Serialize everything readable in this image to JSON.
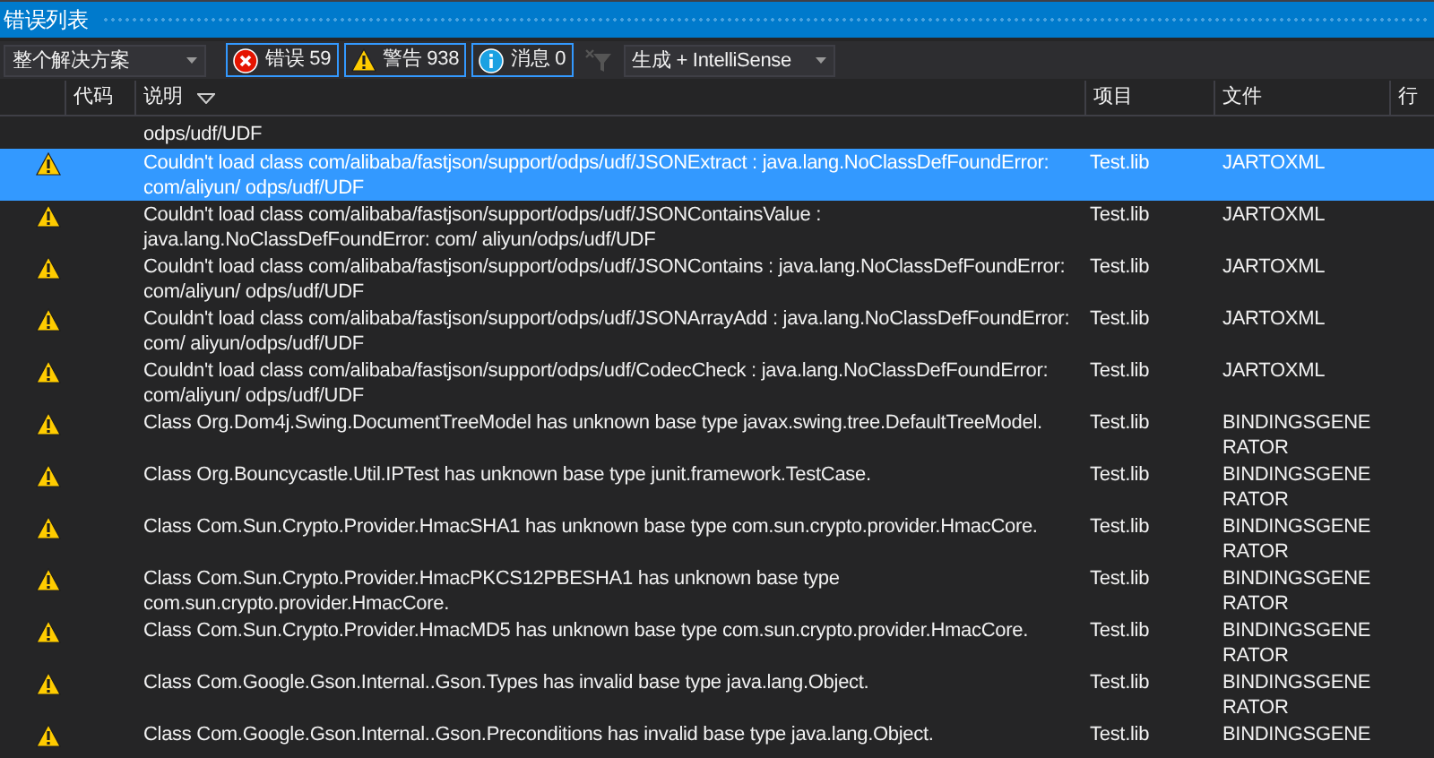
{
  "window": {
    "title": "错误列表"
  },
  "toolbar": {
    "scope": "整个解决方案",
    "filters": [
      {
        "kind": "error",
        "label": "错误 59",
        "selected": true
      },
      {
        "kind": "warning",
        "label": "警告 938",
        "selected": true
      },
      {
        "kind": "info",
        "label": "消息 0",
        "selected": true
      }
    ],
    "filter_button": {
      "disabled": true
    },
    "source": "生成 + IntelliSense"
  },
  "table": {
    "columns": [
      "代码",
      "说明",
      "项目",
      "文件",
      "行"
    ],
    "rows": [
      {
        "kind": "partial",
        "description": "odps/udf/UDF",
        "selected": false
      },
      {
        "kind": "warning",
        "description": "Couldn't load class com/alibaba/fastjson/support/odps/udf/JSONExtract : java.lang.NoClassDefFoundError: com/aliyun/ odps/udf/UDF",
        "project": "Test.lib",
        "file": "JARTOXML",
        "selected": true
      },
      {
        "kind": "warning",
        "description": "Couldn't load class com/alibaba/fastjson/support/odps/udf/JSONContainsValue : java.lang.NoClassDefFoundError: com/ aliyun/odps/udf/UDF",
        "project": "Test.lib",
        "file": "JARTOXML",
        "selected": false
      },
      {
        "kind": "warning",
        "description": "Couldn't load class com/alibaba/fastjson/support/odps/udf/JSONContains : java.lang.NoClassDefFoundError: com/aliyun/ odps/udf/UDF",
        "project": "Test.lib",
        "file": "JARTOXML",
        "selected": false
      },
      {
        "kind": "warning",
        "description": "Couldn't load class com/alibaba/fastjson/support/odps/udf/JSONArrayAdd : java.lang.NoClassDefFoundError: com/ aliyun/odps/udf/UDF",
        "project": "Test.lib",
        "file": "JARTOXML",
        "selected": false
      },
      {
        "kind": "warning",
        "description": "Couldn't load class com/alibaba/fastjson/support/odps/udf/CodecCheck : java.lang.NoClassDefFoundError: com/aliyun/ odps/udf/UDF",
        "project": "Test.lib",
        "file": "JARTOXML",
        "selected": false
      },
      {
        "kind": "warning",
        "description": "Class Org.Dom4j.Swing.DocumentTreeModel has unknown base type javax.swing.tree.DefaultTreeModel.",
        "project": "Test.lib",
        "file": "BINDINGSGENE RATOR",
        "selected": false
      },
      {
        "kind": "warning",
        "description": "Class Org.Bouncycastle.Util.IPTest has unknown base type junit.framework.TestCase.",
        "project": "Test.lib",
        "file": "BINDINGSGENE RATOR",
        "selected": false
      },
      {
        "kind": "warning",
        "description": "Class Com.Sun.Crypto.Provider.HmacSHA1 has unknown base type com.sun.crypto.provider.HmacCore.",
        "project": "Test.lib",
        "file": "BINDINGSGENE RATOR",
        "selected": false
      },
      {
        "kind": "warning",
        "description": "Class Com.Sun.Crypto.Provider.HmacPKCS12PBESHA1 has unknown base type com.sun.crypto.provider.HmacCore.",
        "project": "Test.lib",
        "file": "BINDINGSGENE RATOR",
        "selected": false
      },
      {
        "kind": "warning",
        "description": "Class Com.Sun.Crypto.Provider.HmacMD5 has unknown base type com.sun.crypto.provider.HmacCore.",
        "project": "Test.lib",
        "file": "BINDINGSGENE RATOR",
        "selected": false
      },
      {
        "kind": "warning",
        "description": "Class Com.Google.Gson.Internal..Gson.Types has invalid base type java.lang.Object.",
        "project": "Test.lib",
        "file": "BINDINGSGENE RATOR",
        "selected": false
      },
      {
        "kind": "warning",
        "description": "Class Com.Google.Gson.Internal..Gson.Preconditions has invalid base type java.lang.Object.",
        "project": "Test.lib",
        "file": "BINDINGSGENE",
        "selected": false
      }
    ]
  }
}
